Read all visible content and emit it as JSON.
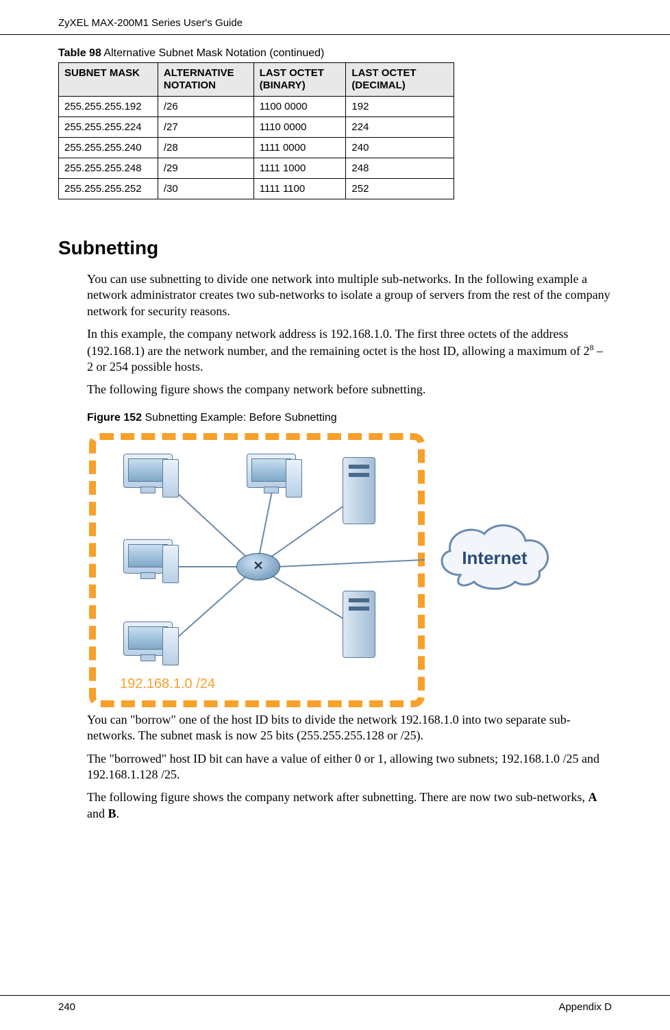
{
  "header": {
    "title": "ZyXEL MAX-200M1 Series User's Guide"
  },
  "table": {
    "caption_bold": "Table 98",
    "caption_rest": "   Alternative Subnet Mask Notation (continued)",
    "headers": [
      "SUBNET MASK",
      "ALTERNATIVE NOTATION",
      "LAST OCTET (BINARY)",
      "LAST OCTET (DECIMAL)"
    ],
    "rows": [
      [
        "255.255.255.192",
        "/26",
        "1100 0000",
        "192"
      ],
      [
        "255.255.255.224",
        "/27",
        "1110 0000",
        "224"
      ],
      [
        "255.255.255.240",
        "/28",
        "1111 0000",
        "240"
      ],
      [
        "255.255.255.248",
        "/29",
        "1111 1000",
        "248"
      ],
      [
        "255.255.255.252",
        "/30",
        "1111 1100",
        "252"
      ]
    ]
  },
  "section": {
    "heading": "Subnetting",
    "p1": "You can use subnetting to divide one network into multiple sub-networks. In the following example a network administrator creates two sub-networks to isolate a group of servers from the rest of the company network for security reasons.",
    "p2_a": "In this example, the company network address is 192.168.1.0. The first three octets of the address (192.168.1) are the network number, and the remaining octet is the host ID, allowing a maximum of 2",
    "p2_sup": "8",
    "p2_b": " – 2 or 254 possible hosts.",
    "p3": "The following figure shows the company network before subnetting.",
    "fig_bold": "Figure 152",
    "fig_rest": "   Subnetting Example: Before Subnetting",
    "fig_label": "192.168.1.0 /24",
    "cloud_label": "Internet",
    "p4": "You can \"borrow\" one of the host ID bits to divide the network 192.168.1.0 into two separate sub-networks. The subnet mask is now 25 bits (255.255.255.128 or /25).",
    "p5": "The \"borrowed\" host ID bit can have a value of either 0 or 1, allowing two subnets; 192.168.1.0 /25 and 192.168.1.128 /25.",
    "p6_a": "The following figure shows the company network after subnetting. There are now two sub-networks, ",
    "p6_bold1": "A",
    "p6_mid": " and ",
    "p6_bold2": "B",
    "p6_end": "."
  },
  "footer": {
    "page": "240",
    "appendix": "Appendix D"
  }
}
